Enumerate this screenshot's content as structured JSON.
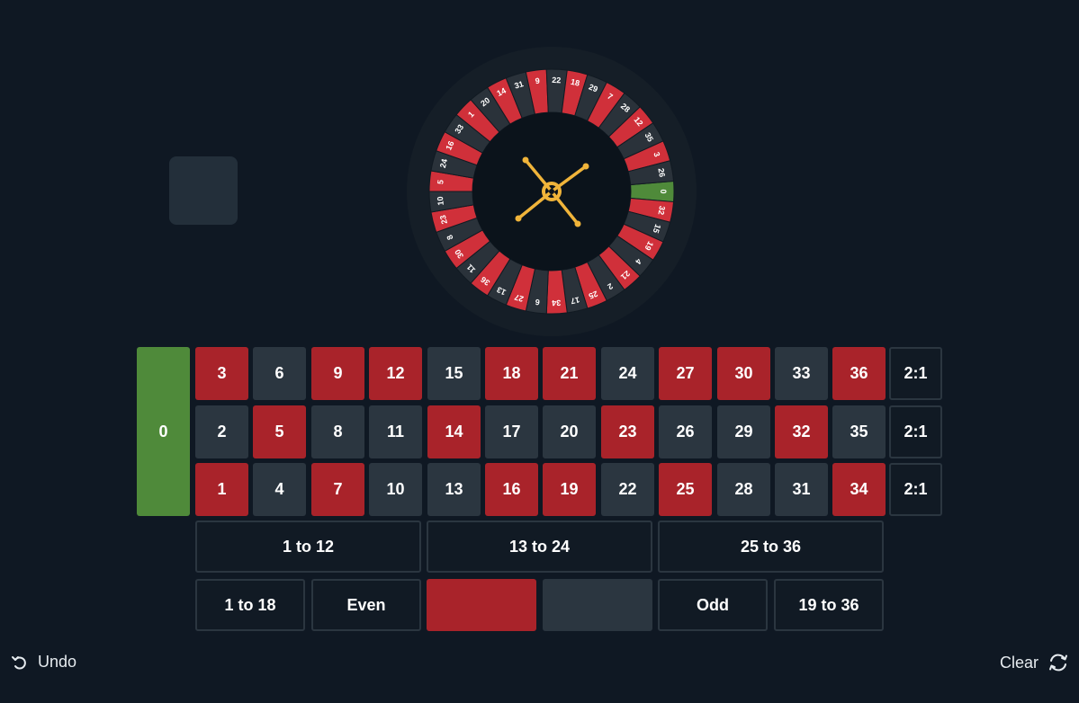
{
  "wheel": {
    "sequence": [
      "0",
      "32",
      "15",
      "19",
      "4",
      "21",
      "2",
      "25",
      "17",
      "34",
      "6",
      "27",
      "13",
      "36",
      "11",
      "30",
      "8",
      "23",
      "10",
      "5",
      "24",
      "16",
      "33",
      "1",
      "20",
      "14",
      "31",
      "9",
      "22",
      "18",
      "29",
      "7",
      "28",
      "12",
      "35",
      "3",
      "26"
    ],
    "colors": {
      "red": "#d0303a",
      "black": "#2a323a",
      "green": "#4f8a3a",
      "hub": "#0b131b",
      "rim": "#151e27",
      "spinner": "#f0b43a"
    }
  },
  "board": {
    "zero": "0",
    "rows": [
      [
        {
          "n": "3",
          "c": "red"
        },
        {
          "n": "6",
          "c": "black"
        },
        {
          "n": "9",
          "c": "red"
        },
        {
          "n": "12",
          "c": "red"
        },
        {
          "n": "15",
          "c": "black"
        },
        {
          "n": "18",
          "c": "red"
        },
        {
          "n": "21",
          "c": "red"
        },
        {
          "n": "24",
          "c": "black"
        },
        {
          "n": "27",
          "c": "red"
        },
        {
          "n": "30",
          "c": "red"
        },
        {
          "n": "33",
          "c": "black"
        },
        {
          "n": "36",
          "c": "red"
        }
      ],
      [
        {
          "n": "2",
          "c": "black"
        },
        {
          "n": "5",
          "c": "red"
        },
        {
          "n": "8",
          "c": "black"
        },
        {
          "n": "11",
          "c": "black"
        },
        {
          "n": "14",
          "c": "red"
        },
        {
          "n": "17",
          "c": "black"
        },
        {
          "n": "20",
          "c": "black"
        },
        {
          "n": "23",
          "c": "red"
        },
        {
          "n": "26",
          "c": "black"
        },
        {
          "n": "29",
          "c": "black"
        },
        {
          "n": "32",
          "c": "red"
        },
        {
          "n": "35",
          "c": "black"
        }
      ],
      [
        {
          "n": "1",
          "c": "red"
        },
        {
          "n": "4",
          "c": "black"
        },
        {
          "n": "7",
          "c": "red"
        },
        {
          "n": "10",
          "c": "black"
        },
        {
          "n": "13",
          "c": "black"
        },
        {
          "n": "16",
          "c": "red"
        },
        {
          "n": "19",
          "c": "red"
        },
        {
          "n": "22",
          "c": "black"
        },
        {
          "n": "25",
          "c": "red"
        },
        {
          "n": "28",
          "c": "black"
        },
        {
          "n": "31",
          "c": "black"
        },
        {
          "n": "34",
          "c": "red"
        }
      ]
    ],
    "column_bets": [
      "2:1",
      "2:1",
      "2:1"
    ],
    "dozens": [
      "1 to 12",
      "13 to 24",
      "25 to 36"
    ],
    "even_money": {
      "low": "1 to 18",
      "even": "Even",
      "odd": "Odd",
      "high": "19 to 36"
    }
  },
  "controls": {
    "undo": "Undo",
    "clear": "Clear"
  }
}
